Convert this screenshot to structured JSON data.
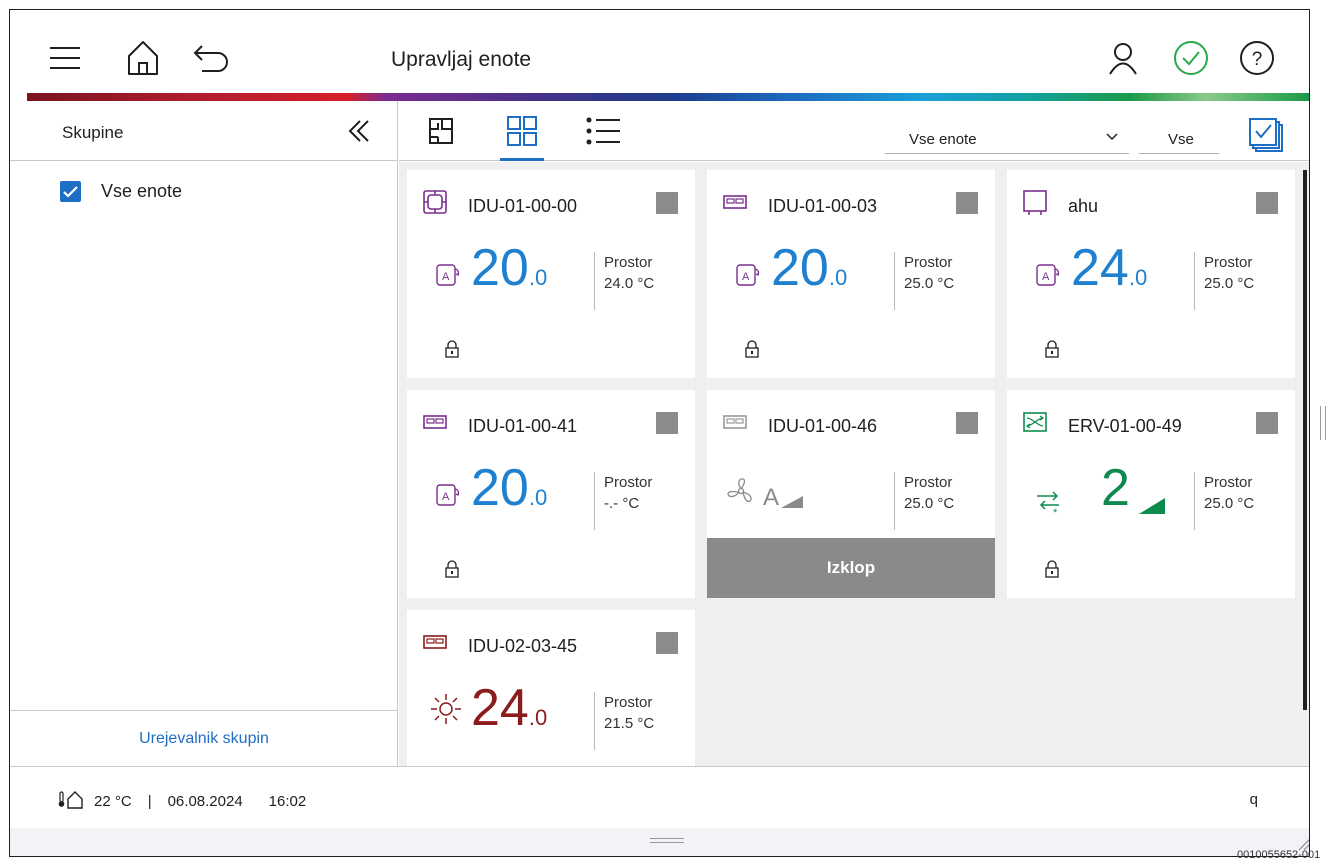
{
  "header": {
    "title": "Upravljaj enote",
    "icons": [
      "menu-icon",
      "home-icon",
      "back-icon",
      "user-icon",
      "status-ok-icon",
      "help-icon"
    ]
  },
  "sidebar": {
    "title": "Skupine",
    "groups": [
      {
        "label": "Vse enote",
        "checked": true
      }
    ],
    "footer_link": "Urejevalnik skupin"
  },
  "toolbar": {
    "views": [
      "floorplan-view",
      "grid-view",
      "list-view"
    ],
    "active_view": "grid-view",
    "filter_value": "Vse enote",
    "filter2_value": "Vse"
  },
  "units": [
    {
      "name": "IDU-01-00-00",
      "icon": "cassette-4way-icon",
      "mode": "auto-icon",
      "setpoint": "20",
      "setpoint_dec": ".0",
      "room_label": "Prostor",
      "room_temp": "24.0 °C",
      "locked": true,
      "color": "#1f80d0"
    },
    {
      "name": "IDU-01-00-03",
      "icon": "wall-unit-icon",
      "mode": "auto-icon",
      "setpoint": "20",
      "setpoint_dec": ".0",
      "room_label": "Prostor",
      "room_temp": "25.0 °C",
      "locked": true,
      "color": "#1f80d0"
    },
    {
      "name": "ahu",
      "icon": "ahu-icon",
      "mode": "auto-icon",
      "setpoint": "24",
      "setpoint_dec": ".0",
      "room_label": "Prostor",
      "room_temp": "25.0 °C",
      "locked": true,
      "color": "#1f80d0"
    },
    {
      "name": "IDU-01-00-41",
      "icon": "wall-unit-icon",
      "mode": "auto-icon",
      "setpoint": "20",
      "setpoint_dec": ".0",
      "room_label": "Prostor",
      "room_temp": "-.- °C",
      "locked": true,
      "color": "#1f80d0"
    },
    {
      "name": "IDU-01-00-46",
      "icon": "wall-unit-icon",
      "mode": "fan-icon",
      "fan_label": "A",
      "room_label": "Prostor",
      "room_temp": "25.0 °C",
      "off_label": "Izklop",
      "color": "#8a8a8a"
    },
    {
      "name": "ERV-01-00-49",
      "icon": "erv-icon",
      "mode": "erv-mode-icon",
      "setpoint": "2",
      "room_label": "Prostor",
      "room_temp": "25.0 °C",
      "locked": true,
      "color": "#0f8a4e"
    },
    {
      "name": "IDU-02-03-45",
      "icon": "wall-unit-icon",
      "mode": "heat-icon",
      "setpoint": "24",
      "setpoint_dec": ".0",
      "room_label": "Prostor",
      "room_temp": "21.5 °C",
      "color": "#8c1c1c"
    }
  ],
  "footer": {
    "outdoor_temp": "22 °C",
    "separator": "|",
    "date": "06.08.2024",
    "time": "16:02",
    "right_text": "q"
  },
  "doc_id": "0010055652-001",
  "colors": {
    "accent_blue": "#1f6ec5",
    "setpoint_blue": "#1f80d0",
    "erv_green": "#0f8a4e",
    "heat_red": "#8c1c1c",
    "icon_purple": "#7a2e8e",
    "status_green": "#2aa84a",
    "disabled_gray": "#8a8a8a"
  }
}
